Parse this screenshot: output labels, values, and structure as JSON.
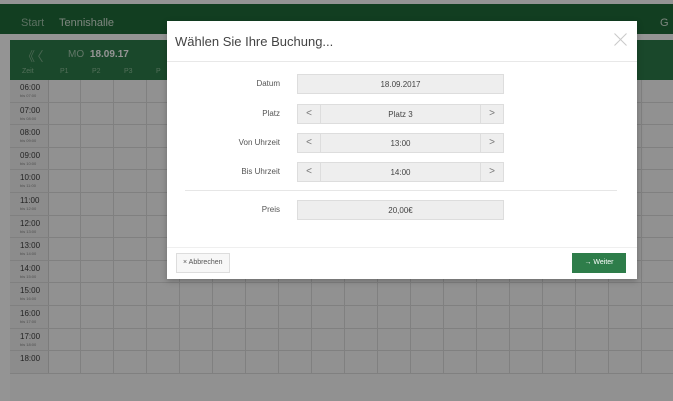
{
  "nav": {
    "start": "Start",
    "tennis": "Tennishalle",
    "right_cut": "G"
  },
  "calendar": {
    "nav_arrows": "《〈",
    "weekday": "MO",
    "date": "18.09.17",
    "columns": [
      "Zeit",
      "P1",
      "P2",
      "P3",
      "P"
    ],
    "rows": [
      {
        "time": "06:00",
        "sub": "bis 07:00"
      },
      {
        "time": "07:00",
        "sub": "bis 08:00"
      },
      {
        "time": "08:00",
        "sub": "bis 09:00"
      },
      {
        "time": "09:00",
        "sub": "bis 10:00"
      },
      {
        "time": "10:00",
        "sub": "bis 11:00"
      },
      {
        "time": "11:00",
        "sub": "bis 12:00"
      },
      {
        "time": "12:00",
        "sub": "bis 13:00"
      },
      {
        "time": "13:00",
        "sub": "bis 14:00"
      },
      {
        "time": "14:00",
        "sub": "bis 15:00"
      },
      {
        "time": "15:00",
        "sub": "bis 16:00"
      },
      {
        "time": "16:00",
        "sub": "bis 17:00"
      },
      {
        "time": "17:00",
        "sub": "bis 18:00"
      },
      {
        "time": "18:00",
        "sub": ""
      }
    ]
  },
  "modal": {
    "title": "Wählen Sie Ihre Buchung...",
    "datum_label": "Datum",
    "datum_value": "18.09.2017",
    "platz_label": "Platz",
    "platz_value": "Platz 3",
    "von_label": "Von Uhrzeit",
    "von_value": "13:00",
    "bis_label": "Bis Uhrzeit",
    "bis_value": "14:00",
    "preis_label": "Preis",
    "preis_value": "20,00€",
    "cancel_label": "× Abbrechen",
    "next_label": "→ Weiter"
  },
  "icons": {
    "close": "close-icon",
    "prev": "chevron-left-icon",
    "next": "chevron-right-icon"
  },
  "colors": {
    "brand_green": "#2e7d4a"
  }
}
